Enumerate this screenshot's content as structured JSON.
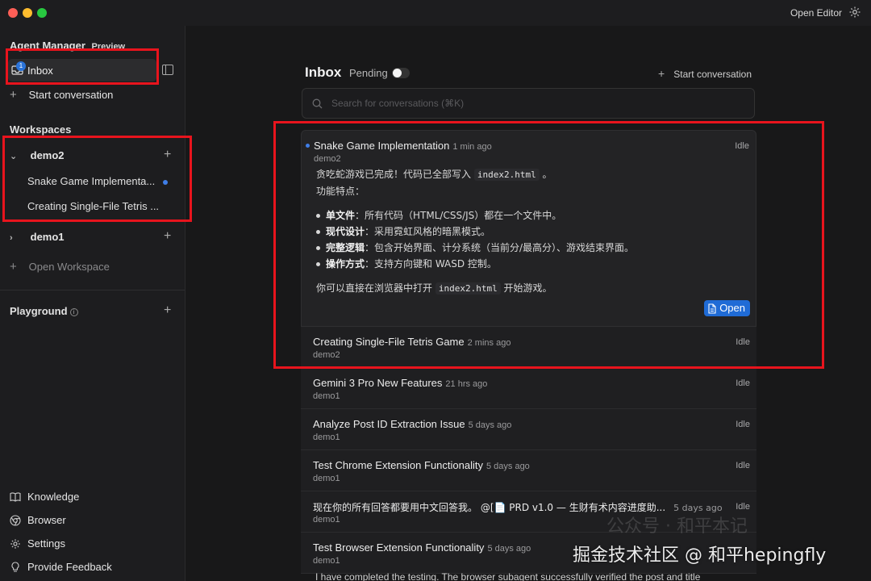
{
  "titlebar": {
    "open_editor": "Open Editor"
  },
  "sidebar": {
    "heading": "Agent Manager",
    "preview_badge": "Preview",
    "inbox": {
      "label": "Inbox",
      "count": "1"
    },
    "start_conversation": "Start conversation",
    "workspaces_heading": "Workspaces",
    "workspaces": [
      {
        "name": "demo2",
        "expanded": true,
        "items": [
          "Snake Game Implementa...",
          "Creating Single-File Tetris ..."
        ]
      },
      {
        "name": "demo1",
        "expanded": false
      }
    ],
    "open_workspace": "Open Workspace",
    "playground": "Playground",
    "bottom": [
      {
        "label": "Knowledge",
        "icon": "book-icon"
      },
      {
        "label": "Browser",
        "icon": "chrome-icon"
      },
      {
        "label": "Settings",
        "icon": "gear-icon"
      },
      {
        "label": "Provide Feedback",
        "icon": "lightbulb-icon"
      }
    ]
  },
  "main": {
    "title": "Inbox",
    "pending_label": "Pending",
    "start_conversation": "Start conversation",
    "search_placeholder": "Search for conversations (⌘K)",
    "conversations": [
      {
        "title": "Snake Game Implementation",
        "time": "1 min ago",
        "workspace": "demo2",
        "status": "Idle",
        "body": {
          "intro_prefix": "贪吃蛇游戏已完成！代码已全部写入",
          "intro_code": "index2.html",
          "intro_suffix": "。",
          "features_heading": "功能特点：",
          "bullets": [
            {
              "key": "单文件",
              "text": "：所有代码（HTML/CSS/JS）都在一个文件中。"
            },
            {
              "key": "现代设计",
              "text": "：采用霓虹风格的暗黑模式。"
            },
            {
              "key": "完整逻辑",
              "text": "：包含开始界面、计分系统（当前分/最高分）、游戏结束界面。"
            },
            {
              "key": "操作方式",
              "text": "：支持方向键和 WASD 控制。"
            }
          ],
          "outro_prefix": "你可以直接在浏览器中打开",
          "outro_code": "index2.html",
          "outro_suffix": "开始游戏。"
        },
        "open_label": "Open"
      },
      {
        "title": "Creating Single-File Tetris Game",
        "time": "2 mins ago",
        "workspace": "demo2",
        "status": "Idle"
      },
      {
        "title": "Gemini 3 Pro New Features",
        "time": "21 hrs ago",
        "workspace": "demo1",
        "status": "Idle"
      },
      {
        "title": "Analyze Post ID Extraction Issue",
        "time": "5 days ago",
        "workspace": "demo1",
        "status": "Idle"
      },
      {
        "title": "Test Chrome Extension Functionality",
        "time": "5 days ago",
        "workspace": "demo1",
        "status": "Idle"
      },
      {
        "title": "现在你的所有回答都要用中文回答我。 @[📄 PRD v1.0 — 生财有术内容进度助...",
        "time": "5 days ago",
        "workspace": "demo1",
        "status": "Idle"
      },
      {
        "title": "Test Browser Extension Functionality",
        "time": "5 days ago",
        "workspace": "demo1",
        "status": ""
      }
    ],
    "last_snippet": "I have completed the testing. The browser subagent successfully verified the post and title"
  },
  "watermark": "掘金技术社区 @ 和平hepingfly",
  "watermark_faint": "公众号 · 和平本记"
}
